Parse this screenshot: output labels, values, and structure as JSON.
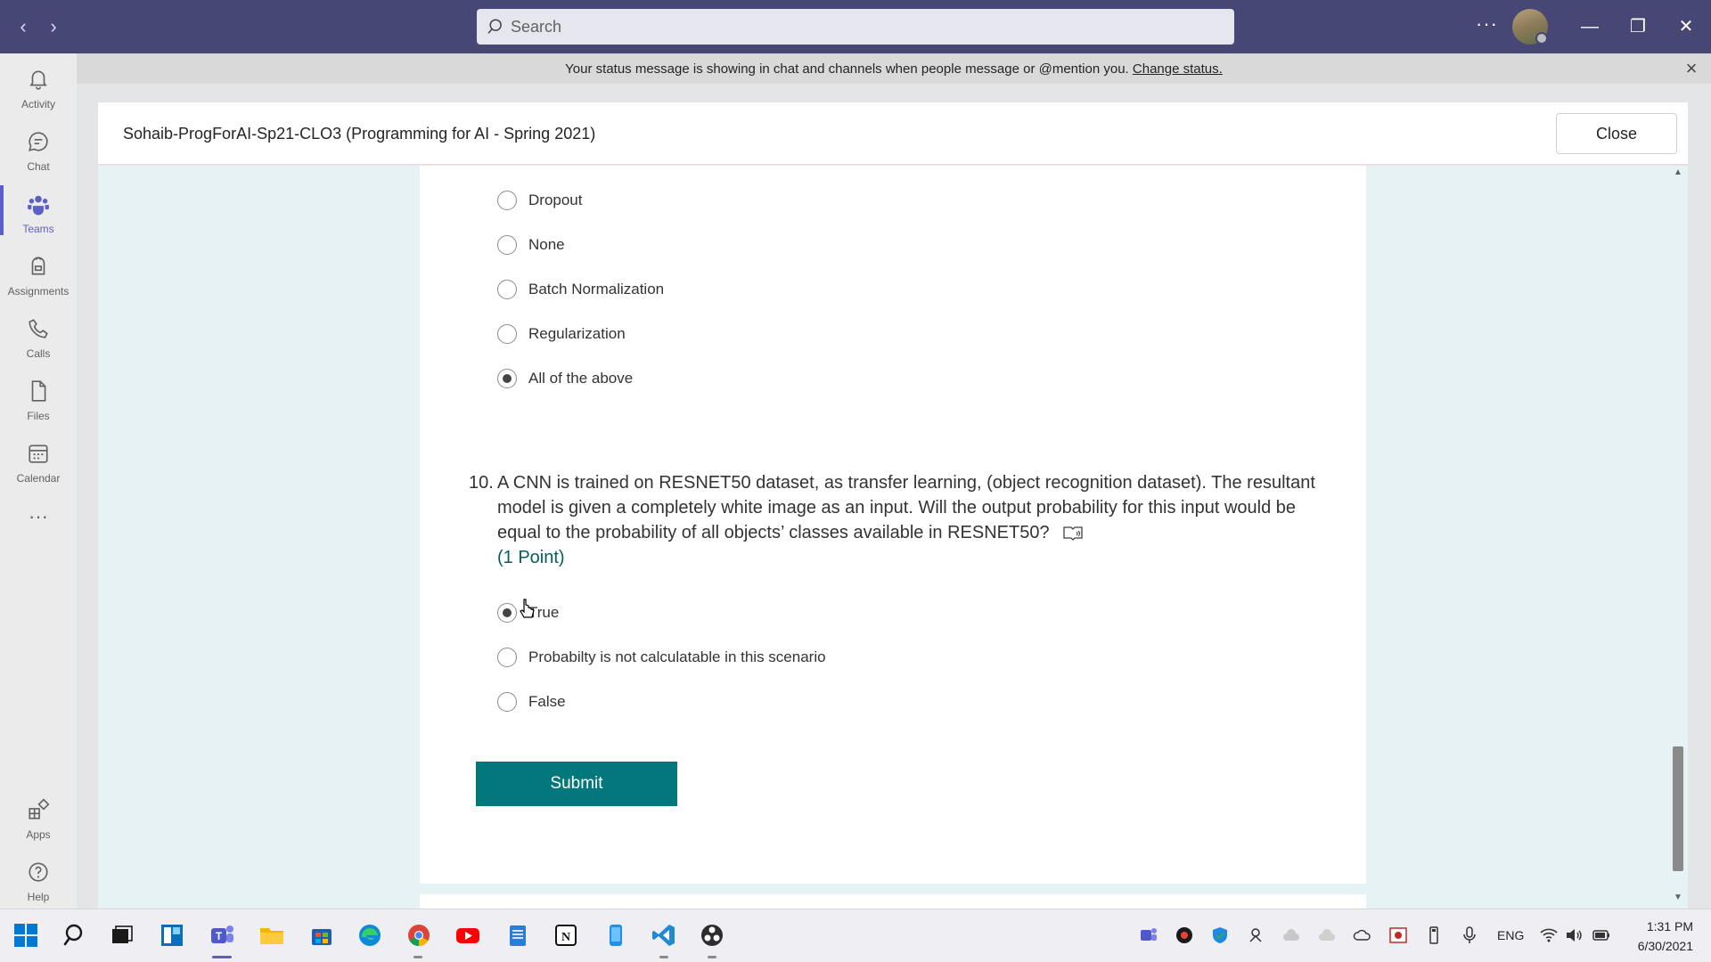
{
  "titlebar": {
    "search_placeholder": "Search",
    "more_label": "···"
  },
  "rail": {
    "items": [
      {
        "label": "Activity",
        "icon": "bell-icon"
      },
      {
        "label": "Chat",
        "icon": "chat-icon"
      },
      {
        "label": "Teams",
        "icon": "teams-icon"
      },
      {
        "label": "Assignments",
        "icon": "assignments-icon"
      },
      {
        "label": "Calls",
        "icon": "phone-icon"
      },
      {
        "label": "Files",
        "icon": "file-icon"
      },
      {
        "label": "Calendar",
        "icon": "calendar-icon"
      },
      {
        "label": "···",
        "icon": "more-icon"
      },
      {
        "label": "Apps",
        "icon": "apps-icon"
      },
      {
        "label": "Help",
        "icon": "help-icon"
      }
    ],
    "active": "Teams"
  },
  "banner": {
    "text": "Your status message is showing in chat and channels when people message or @mention you.",
    "link": "Change status."
  },
  "header": {
    "title": "Sohaib-ProgForAI-Sp21-CLO3 (Programming for AI - Spring 2021)",
    "close_label": "Close"
  },
  "form": {
    "previous_options": [
      {
        "label": "Dropout",
        "selected": false
      },
      {
        "label": "None",
        "selected": false
      },
      {
        "label": "Batch Normalization",
        "selected": false
      },
      {
        "label": "Regularization",
        "selected": false
      },
      {
        "label": "All of the above",
        "selected": true
      }
    ],
    "question": {
      "number": "10.",
      "text": "A CNN is trained on RESNET50 dataset, as transfer learning, (object recognition dataset). The resultant model is given a completely white image as an input. Will the output probability for this input would be equal to the probability of all objects’ classes available in RESNET50?",
      "points": "(1 Point)",
      "options": [
        {
          "label": "True",
          "selected": true
        },
        {
          "label": "Probabilty is not calculatable in this scenario",
          "selected": false
        },
        {
          "label": "False",
          "selected": false
        }
      ]
    },
    "submit_label": "Submit"
  },
  "taskbar": {
    "apps": [
      "windows-start-icon",
      "search-icon",
      "task-view-icon",
      "widgets-icon",
      "teams-icon",
      "file-explorer-icon",
      "store-icon",
      "edge-icon",
      "chrome-icon",
      "youtube-icon",
      "notepad-icon",
      "notion-icon",
      "phone-link-icon",
      "vscode-icon",
      "obs-icon"
    ],
    "tray_lang": "ENG",
    "time": "1:31 PM",
    "date": "6/30/2021"
  },
  "colors": {
    "titlebar": "#464775",
    "accent": "#5b5fc7",
    "submit": "#03787c",
    "points": "#035e64"
  }
}
